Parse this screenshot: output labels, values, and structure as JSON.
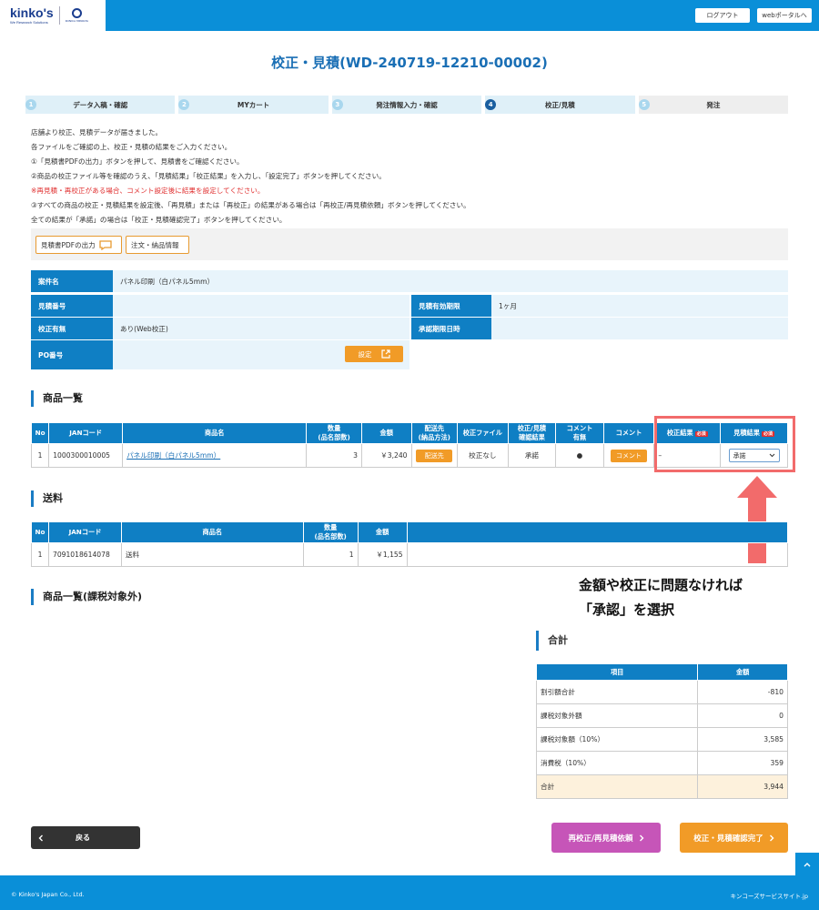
{
  "header": {
    "logo_text": "kinko's",
    "logo_sub": "We Research Solutions",
    "partner_logo_text": "KONICA MINOLTA",
    "logout_label": "ログアウト",
    "portal_label": "webポータルへ"
  },
  "page_title": "校正・見積(WD-240719-12210-00002)",
  "steps": [
    {
      "num": "1",
      "label": "データ入稿・確認"
    },
    {
      "num": "2",
      "label": "MYカート"
    },
    {
      "num": "3",
      "label": "発注情報入力・確認"
    },
    {
      "num": "4",
      "label": "校正/見積"
    },
    {
      "num": "5",
      "label": "発注"
    }
  ],
  "instructions": [
    "店舗より校正、見積データが届きました。",
    "各ファイルをご確認の上、校正・見積の結果をご入力ください。",
    "①「見積書PDFの出力」ボタンを押して、見積書をご確認ください。",
    "②商品の校正ファイル等を確認のうえ、「見積結果」「校正結果」を入力し、「設定完了」ボタンを押してください。",
    "※再見積・再校正がある場合、コメント設定後に結果を設定してください。",
    "③すべての商品の校正・見積結果を設定後、「再見積」または「再校正」の結果がある場合は「再校正/再見積依頼」ボタンを押してください。",
    "全ての結果が「承諾」の場合は「校正・見積確認完了」ボタンを押してください。"
  ],
  "actions": {
    "pdf_label": "見積書PDFの出力",
    "order_info_label": "注文・納品情報"
  },
  "info": {
    "project_label": "案件名",
    "project_value": "パネル印刷（白パネル5mm）",
    "estimate_no_label": "見積番号",
    "estimate_no_value": "",
    "validity_label": "見積有効期限",
    "validity_value": "1ヶ月",
    "proof_label": "校正有無",
    "proof_value": "あり(Web校正)",
    "approval_label": "承認期限日時",
    "approval_value": "",
    "po_label": "PO番号",
    "po_value": "",
    "setting_label": "設定"
  },
  "products": {
    "title": "商品一覧",
    "headers": [
      "No",
      "JANコード",
      "商品名",
      "数量",
      "(品名部数)",
      "金額",
      "配送先",
      "(納品方法)",
      "校正ファイル",
      "校正/見積",
      "確認結果",
      "コメント",
      "有無",
      "コメント",
      "校正結果",
      "見積結果"
    ],
    "required_badge": "必須",
    "row": {
      "no": "1",
      "jan": "1000300010005",
      "name": "パネル印刷（白パネル5mm）",
      "qty": "3",
      "amount": "￥3,240",
      "ship_btn": "配送先",
      "proof_file": "校正なし",
      "confirm": "承諾",
      "comment_exists": "●",
      "comment_btn": "コメント",
      "proof_result": "–",
      "estimate_result": "承諾"
    }
  },
  "shipping": {
    "title": "送料",
    "headers": [
      "No",
      "JANコード",
      "商品名",
      "数量",
      "(品名部数)",
      "金額"
    ],
    "row": {
      "no": "1",
      "jan": "7091018614078",
      "name": "送料",
      "qty": "1",
      "amount": "￥1,155"
    }
  },
  "nontax_title": "商品一覧(課税対象外)",
  "callout": {
    "line1": "金額や校正に問題なければ",
    "line2": "「承認」を選択"
  },
  "totals": {
    "title": "合計",
    "col_item": "項目",
    "col_amount": "金額",
    "rows": [
      {
        "label": "割引額合計",
        "value": "-810"
      },
      {
        "label": "課税対象外額",
        "value": "0"
      },
      {
        "label": "課税対象額（10%）",
        "value": "3,585"
      },
      {
        "label": "消費税（10%）",
        "value": "359"
      },
      {
        "label": "合計",
        "value": "3,944"
      }
    ]
  },
  "buttons": {
    "back": "戻る",
    "re_request": "再校正/再見積依頼",
    "confirm": "校正・見積確認完了"
  },
  "footer": {
    "copyright": "© Kinko's Japan Co., Ltd.",
    "site_link": "キンコーズサービスサイト.jp"
  }
}
